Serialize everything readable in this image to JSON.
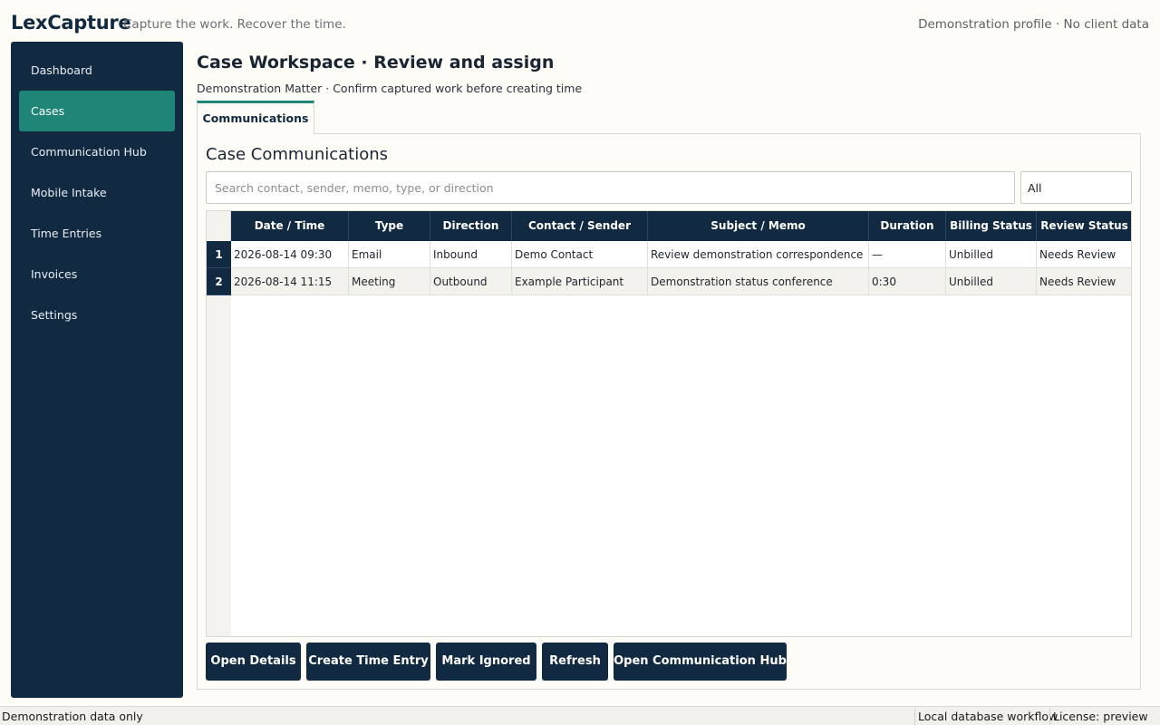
{
  "header": {
    "brand": "LexCapture",
    "tagline": "Capture the work. Recover the time.",
    "profile": "Demonstration profile · No client data"
  },
  "sidebar": {
    "items": [
      {
        "label": "Dashboard"
      },
      {
        "label": "Cases",
        "active": true
      },
      {
        "label": "Communication Hub"
      },
      {
        "label": "Mobile Intake"
      },
      {
        "label": "Time Entries"
      },
      {
        "label": "Invoices"
      },
      {
        "label": "Settings"
      }
    ]
  },
  "main": {
    "title": "Case Workspace · Review and assign",
    "subtitle": "Demonstration Matter · Confirm captured work before creating time",
    "tabs": [
      {
        "label": "Communications"
      }
    ],
    "panel_title": "Case Communications",
    "search": {
      "placeholder": "Search contact, sender, memo, type, or direction",
      "value": ""
    },
    "filter": {
      "value": "All"
    }
  },
  "table": {
    "columns": [
      "Date / Time",
      "Type",
      "Direction",
      "Contact / Sender",
      "Subject / Memo",
      "Duration",
      "Billing Status",
      "Review Status"
    ],
    "rows": [
      {
        "num": "1",
        "cells": [
          "2026-08-14 09:30",
          "Email",
          "Inbound",
          "Demo Contact",
          "Review demonstration correspondence",
          "—",
          "Unbilled",
          "Needs Review"
        ]
      },
      {
        "num": "2",
        "cells": [
          "2026-08-14 11:15",
          "Meeting",
          "Outbound",
          "Example Participant",
          "Demonstration status conference",
          "0:30",
          "Unbilled",
          "Needs Review"
        ]
      }
    ]
  },
  "actions": {
    "open_details": "Open Details",
    "create_time_entry": "Create Time Entry",
    "mark_ignored": "Mark Ignored",
    "refresh": "Refresh",
    "open_hub": "Open Communication Hub"
  },
  "statusbar": {
    "left": "Demonstration data only",
    "workflow": "Local database workflow",
    "license": "License: preview"
  },
  "colors": {
    "navy": "#112a42",
    "teal_active": "#1e8577",
    "background": "#fdfcf7"
  }
}
